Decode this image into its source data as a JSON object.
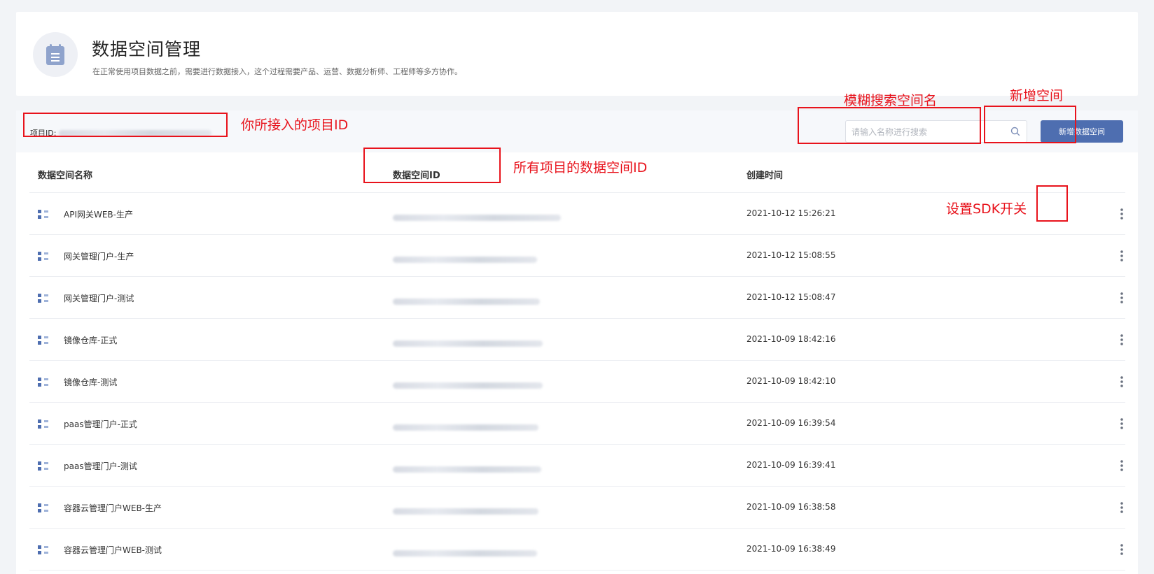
{
  "header": {
    "title": "数据空间管理",
    "description": "在正常使用项目数据之前，需要进行数据接入，这个过程需要产品、运营、数据分析师、工程师等多方协作。",
    "icon": "calendar-list-icon"
  },
  "toolbar": {
    "project_id_label": "项目ID:",
    "search_placeholder": "请输入名称进行搜索",
    "add_button_label": "新增数据空间"
  },
  "table": {
    "columns": [
      "数据空间名称",
      "数据空间ID",
      "创建时间"
    ],
    "rows": [
      {
        "name": "API网关WEB-生产",
        "created": "2021-10-12 15:26:21"
      },
      {
        "name": "网关管理门户-生产",
        "created": "2021-10-12 15:08:55"
      },
      {
        "name": "网关管理门户-测试",
        "created": "2021-10-12 15:08:47"
      },
      {
        "name": "镜像仓库-正式",
        "created": "2021-10-09 18:42:16"
      },
      {
        "name": "镜像仓库-测试",
        "created": "2021-10-09 18:42:10"
      },
      {
        "name": "paas管理门户-正式",
        "created": "2021-10-09 16:39:54"
      },
      {
        "name": "paas管理门户-测试",
        "created": "2021-10-09 16:39:41"
      },
      {
        "name": "容器云管理门户WEB-生产",
        "created": "2021-10-09 16:38:58"
      },
      {
        "name": "容器云管理门户WEB-测试",
        "created": "2021-10-09 16:38:49"
      }
    ]
  },
  "annotations": {
    "project_id": "你所接入的项目ID",
    "space_id": "所有项目的数据空间ID",
    "search": "模糊搜索空间名",
    "add": "新增空间",
    "sdk_switch": "设置SDK开关"
  },
  "colors": {
    "primary": "#4e6eb0",
    "annotation": "#e8131c",
    "page_bg": "#f2f4f7"
  }
}
